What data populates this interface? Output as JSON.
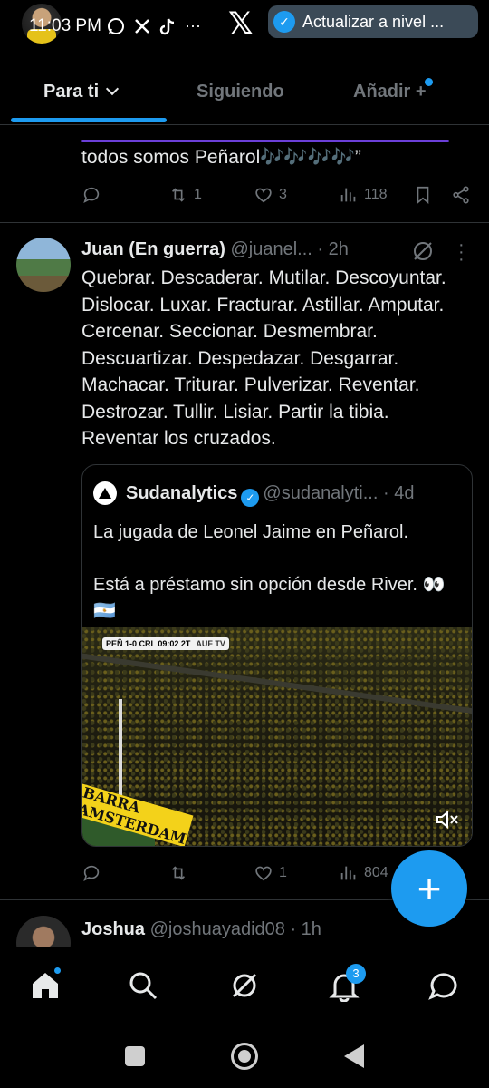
{
  "status_bar": {
    "time": "11:03 PM",
    "notification_text": "Actualizar a nivel ...",
    "icons": [
      "whatsapp-icon",
      "x-icon",
      "tiktok-icon",
      "more-icon"
    ]
  },
  "tabs": [
    {
      "label": "Para ti",
      "active": true
    },
    {
      "label": "Siguiendo",
      "active": false
    },
    {
      "label": "Añadir +",
      "active": false
    }
  ],
  "tweet1": {
    "text_tail": "todos somos Peñarol🎶🎶🎶🎶”",
    "replies": "",
    "reposts": "1",
    "likes": "3",
    "views": "118"
  },
  "tweet2": {
    "name": "Juan (En guerra)",
    "handle": "@juanel...",
    "time": "· 2h",
    "body": "Quebrar. Descaderar. Mutilar. Descoyuntar. Dislocar. Luxar. Fracturar. Astillar. Amputar. Cercenar. Seccionar. Desmembrar. Descuartizar. Despedazar. Desgarrar. Machacar. Triturar. Pulverizar. Reventar. Destrozar. Tullir. Lisiar. Partir la tibia. Reventar los cruzados.",
    "quote": {
      "name": "Sudanalytics",
      "handle": "@sudanalyti...",
      "time": "· 4d",
      "line1": "La jugada de Leonel Jaime en Peñarol.",
      "line2": "Está a préstamo sin opción desde River. 👀🇦🇷",
      "media": {
        "scoreboard": "PEÑ 1-0 CRL 09:02 2T",
        "broadcaster": "AUF TV",
        "banner_text": "BARRA AMSTERDAM"
      }
    },
    "replies": "",
    "reposts": "",
    "likes": "1",
    "views": "804"
  },
  "tweet3": {
    "name": "Joshua",
    "handle": "@joshuayadid08",
    "time": "· 1h"
  },
  "bottom_nav": {
    "notifications_badge": "3"
  },
  "colors": {
    "accent": "#1d9bf0",
    "background": "#000000",
    "muted": "#71767b",
    "text": "#e7e9ea"
  }
}
